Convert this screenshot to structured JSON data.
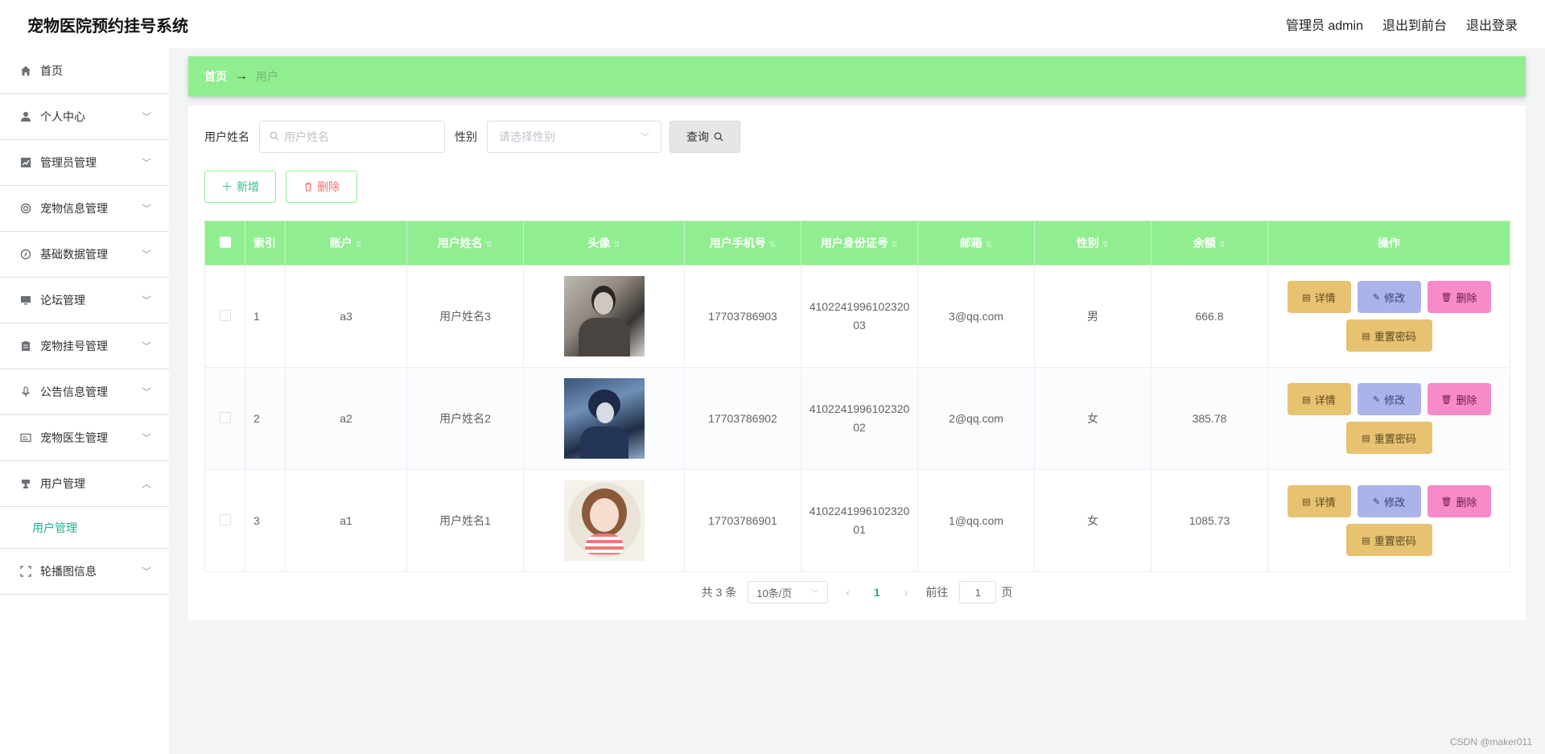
{
  "header": {
    "title": "宠物医院预约挂号系统",
    "admin_label": "管理员 admin",
    "back_label": "退出到前台",
    "logout_label": "退出登录"
  },
  "sidebar": {
    "items": [
      {
        "label": "首页",
        "icon": "home-icon"
      },
      {
        "label": "个人中心",
        "icon": "user-icon"
      },
      {
        "label": "管理员管理",
        "icon": "chart-icon"
      },
      {
        "label": "宠物信息管理",
        "icon": "circle-icon"
      },
      {
        "label": "基础数据管理",
        "icon": "compass-icon"
      },
      {
        "label": "论坛管理",
        "icon": "monitor-icon"
      },
      {
        "label": "宠物挂号管理",
        "icon": "clipboard-icon"
      },
      {
        "label": "公告信息管理",
        "icon": "microphone-icon"
      },
      {
        "label": "宠物医生管理",
        "icon": "card-icon"
      },
      {
        "label": "用户管理",
        "icon": "stamp-icon"
      },
      {
        "label": "轮播图信息",
        "icon": "fullscreen-icon"
      }
    ],
    "sub_item": "用户管理"
  },
  "breadcrumb": {
    "home": "首页",
    "current": "用户"
  },
  "search": {
    "name_label": "用户姓名",
    "name_placeholder": "用户姓名",
    "gender_label": "性别",
    "gender_placeholder": "请选择性别",
    "query_label": "查询"
  },
  "actions": {
    "add_label": "新增",
    "delete_label": "删除"
  },
  "table": {
    "headers": [
      "索引",
      "账户",
      "用户姓名",
      "头像",
      "用户手机号",
      "用户身份证号",
      "邮箱",
      "性别",
      "余额",
      "操作"
    ],
    "rows": [
      {
        "index": "1",
        "account": "a3",
        "name": "用户姓名3",
        "phone": "17703786903",
        "idcard": "410224199610232003",
        "email": "3@qq.com",
        "gender": "男",
        "balance": "666.8"
      },
      {
        "index": "2",
        "account": "a2",
        "name": "用户姓名2",
        "phone": "17703786902",
        "idcard": "410224199610232002",
        "email": "2@qq.com",
        "gender": "女",
        "balance": "385.78"
      },
      {
        "index": "3",
        "account": "a1",
        "name": "用户姓名1",
        "phone": "17703786901",
        "idcard": "410224199610232001",
        "email": "1@qq.com",
        "gender": "女",
        "balance": "1085.73"
      }
    ],
    "op_detail": "详情",
    "op_edit": "修改",
    "op_delete": "删除",
    "op_reset": "重置密码"
  },
  "pagination": {
    "total": "共 3 条",
    "page_size": "10条/页",
    "current_page": "1",
    "goto_prefix": "前往",
    "goto_value": "1",
    "goto_suffix": "页"
  },
  "watermark": "CSDN @maker011",
  "colors": {
    "accent_green": "#90ee90",
    "active_text": "#1fb394",
    "detail_btn": "#e6c271",
    "edit_btn": "#aab4ea",
    "delete_btn": "#f78ac8"
  }
}
